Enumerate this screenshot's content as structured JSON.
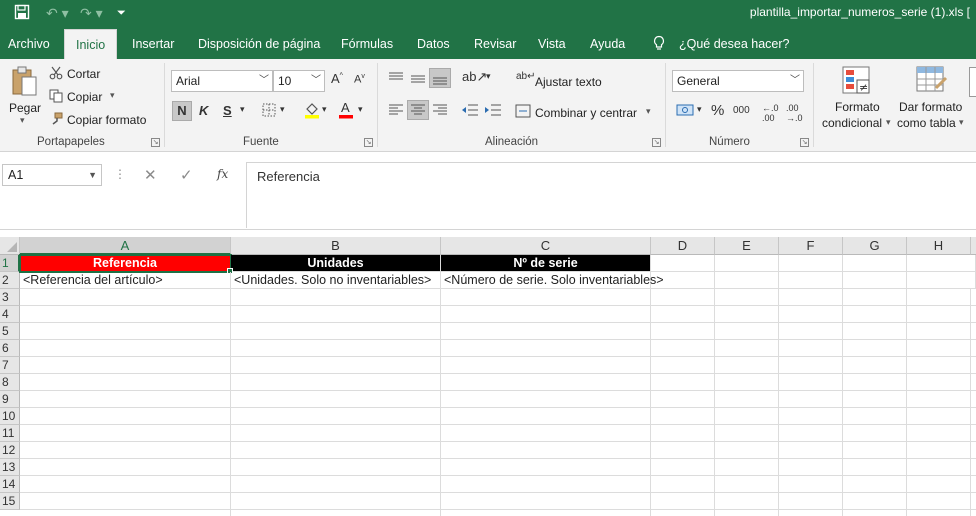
{
  "titlebar": {
    "title": "plantilla_importar_numeros_serie (1).xls  [",
    "save_icon": "save-icon",
    "undo_icon": "undo-icon",
    "redo_icon": "redo-icon"
  },
  "menu": {
    "tabs": [
      "Archivo",
      "Inicio",
      "Insertar",
      "Disposición de página",
      "Fórmulas",
      "Datos",
      "Revisar",
      "Vista",
      "Ayuda"
    ],
    "tell_me": "¿Qué desea hacer?"
  },
  "ribbon": {
    "clipboard": {
      "paste": "Pegar",
      "cut": "Cortar",
      "copy": "Copiar",
      "format_painter": "Copiar formato",
      "label": "Portapapeles"
    },
    "font": {
      "name": "Arial",
      "size": "10",
      "bold": "N",
      "italic": "K",
      "underline": "S",
      "label": "Fuente"
    },
    "alignment": {
      "wrap": "Ajustar texto",
      "merge": "Combinar y centrar",
      "label": "Alineación"
    },
    "number": {
      "format": "General",
      "percent": "%",
      "thousands": "000",
      "label": "Número"
    },
    "styles": {
      "conditional": [
        "Formato",
        "condicional"
      ],
      "as_table": [
        "Dar formato",
        "como tabla"
      ]
    }
  },
  "formula_bar": {
    "name_box": "A1",
    "fx": "fx",
    "content": "Referencia"
  },
  "sheet": {
    "columns": [
      "A",
      "B",
      "C",
      "D",
      "E",
      "F",
      "G",
      "H"
    ],
    "rows": [
      "1",
      "2",
      "3",
      "4",
      "5",
      "6",
      "7",
      "8",
      "9",
      "10",
      "11",
      "12",
      "13",
      "14",
      "15"
    ],
    "row1": [
      "Referencia",
      "Unidades",
      "Nº de serie"
    ],
    "row2": [
      "<Referencia del artículo>",
      "<Unidades. Solo no inventariables>",
      "<Número de serie. Solo inventariables>"
    ]
  },
  "colors": {
    "accent": "#217346",
    "header_red": "#ff0000",
    "header_black": "#000000"
  }
}
